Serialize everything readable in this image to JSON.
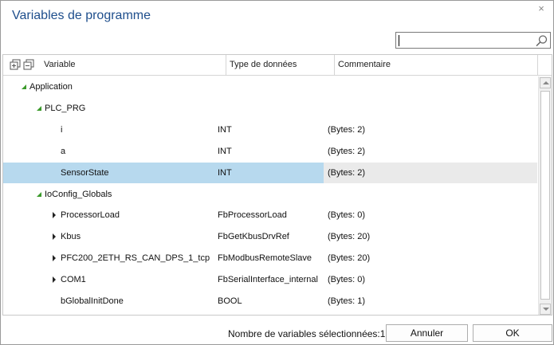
{
  "dialog": {
    "title": "Variables de programme",
    "close_glyph": "×"
  },
  "search": {
    "value": "",
    "placeholder": ""
  },
  "columns": {
    "variable": "Variable",
    "type": "Type de données",
    "comment": "Commentaire"
  },
  "rows": [
    {
      "name": "Application",
      "type": "",
      "comment": "",
      "level": 0,
      "expander": "expanded"
    },
    {
      "name": "PLC_PRG",
      "type": "",
      "comment": "",
      "level": 1,
      "expander": "expanded"
    },
    {
      "name": "i",
      "type": "INT",
      "comment": "(Bytes: 2)",
      "level": 2,
      "expander": "none"
    },
    {
      "name": "a",
      "type": "INT",
      "comment": "(Bytes: 2)",
      "level": 2,
      "expander": "none"
    },
    {
      "name": "SensorState",
      "type": "INT",
      "comment": "(Bytes: 2)",
      "level": 2,
      "expander": "none",
      "selected": true
    },
    {
      "name": "IoConfig_Globals",
      "type": "",
      "comment": "",
      "level": 1,
      "expander": "expanded"
    },
    {
      "name": "ProcessorLoad",
      "type": "FbProcessorLoad",
      "comment": "(Bytes: 0)",
      "level": 2,
      "expander": "collapsed"
    },
    {
      "name": "Kbus",
      "type": "FbGetKbusDrvRef",
      "comment": "(Bytes: 20)",
      "level": 2,
      "expander": "collapsed"
    },
    {
      "name": "PFC200_2ETH_RS_CAN_DPS_1_tcp",
      "type": "FbModbusRemoteSlave",
      "comment": "(Bytes: 20)",
      "level": 2,
      "expander": "collapsed"
    },
    {
      "name": "COM1",
      "type": "FbSerialInterface_internal",
      "comment": "(Bytes: 0)",
      "level": 2,
      "expander": "collapsed"
    },
    {
      "name": "bGlobalInitDone",
      "type": "BOOL",
      "comment": "(Bytes: 1)",
      "level": 2,
      "expander": "none"
    }
  ],
  "footer": {
    "selected_label": "Nombre de variables sélectionnées:1",
    "cancel_label": "Annuler",
    "ok_label": "OK"
  },
  "icons": {
    "search": "magnifier-icon",
    "expand_all": "expand-all-icon",
    "collapse_all": "collapse-all-icon"
  },
  "colors": {
    "title": "#1e4e8c",
    "selection": "#b7d9ee",
    "expanded_triangle": "#3a9a2a"
  }
}
